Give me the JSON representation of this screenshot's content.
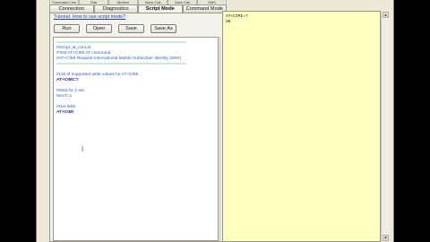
{
  "top_tabs": [
    "Command Line",
    "Dial",
    "Modem",
    "Voice Call",
    "Data Call",
    "SMS"
  ],
  "tabs": [
    "Connection",
    "Diagnostics",
    "Script Mode",
    "Command Mode"
  ],
  "active_tab": "Script Mode",
  "tutorial_link": "Tutorial: How to use script mode?",
  "buttons": {
    "run": "Run",
    "open": "Open",
    "save": "Save",
    "save_as": "Save As"
  },
  "script_lines": [
    {
      "type": "sep",
      "text": "=========================================================="
    },
    {
      "type": "comment",
      "text": "#Script_at_cimi.at"
    },
    {
      "type": "comment",
      "text": "#Test AT+CIMI AT command"
    },
    {
      "type": "comment",
      "text": "#AT+CIMI Request International Mobile Subscriber Identity (IMSI)"
    },
    {
      "type": "sep",
      "text": "=========================================================="
    },
    {
      "type": "blank",
      "text": ""
    },
    {
      "type": "comment",
      "text": "#List of supported write values for AT+CIMI"
    },
    {
      "type": "cmd",
      "text": "AT+CIMI=?"
    },
    {
      "type": "blank",
      "text": ""
    },
    {
      "type": "comment",
      "text": "#Wait for 1 sec"
    },
    {
      "type": "comment",
      "text": "WAIT=1"
    },
    {
      "type": "blank",
      "text": ""
    },
    {
      "type": "comment",
      "text": "#Get IMSI"
    },
    {
      "type": "cmd",
      "text": "AT+CIMI"
    }
  ],
  "console_lines": [
    "AT+CIMI=?",
    "OK"
  ],
  "icons": {
    "cursor": "text-cursor-icon",
    "scroll_up": "scroll-up-arrow-icon",
    "scroll_down": "scroll-down-arrow-icon"
  },
  "colors": {
    "console_bg": "#ffffc0",
    "comment": "#2b5fc9",
    "command": "#1d1da8",
    "separator": "#3ca63c"
  }
}
